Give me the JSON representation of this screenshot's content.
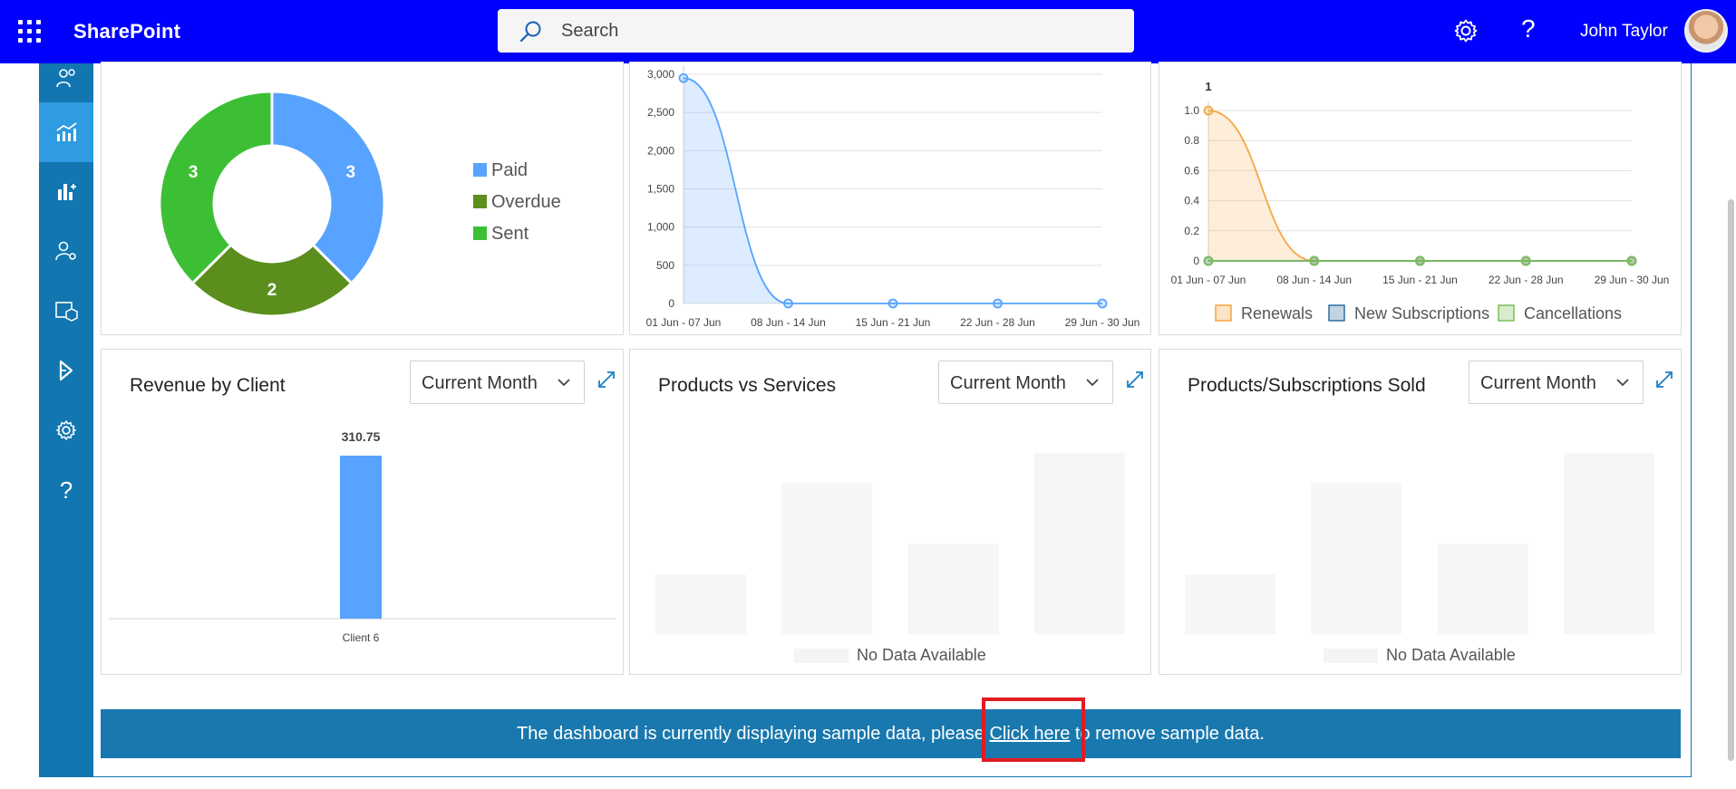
{
  "topbar": {
    "app_name": "SharePoint",
    "search_placeholder": "Search",
    "user_name": "John Taylor"
  },
  "invoice_status": {
    "legend": [
      "Paid",
      "Overdue",
      "Sent"
    ],
    "colors": [
      "#57a3ff",
      "#5b8e1d",
      "#3dbf35"
    ],
    "values": [
      3,
      2,
      3
    ]
  },
  "chart_data": [
    {
      "type": "pie",
      "variant": "donut",
      "categories": [
        "Paid",
        "Overdue",
        "Sent"
      ],
      "values": [
        3,
        2,
        3
      ],
      "colors": [
        "#57a3ff",
        "#5b8e1d",
        "#3dbf35"
      ],
      "legend_position": "right"
    },
    {
      "type": "area",
      "categories": [
        "01 Jun - 07 Jun",
        "08 Jun - 14 Jun",
        "15 Jun - 21 Jun",
        "22 Jun - 28 Jun",
        "29 Jun - 30 Jun"
      ],
      "values": [
        2950,
        0,
        0,
        0,
        0
      ],
      "ylim": [
        0,
        3000
      ],
      "yticks": [
        "3,000",
        "2,500",
        "2,000",
        "1,500",
        "1,000",
        "500",
        "0"
      ],
      "color": "#57a3ff",
      "grid": true
    },
    {
      "type": "area",
      "categories": [
        "01 Jun - 07 Jun",
        "08 Jun - 14 Jun",
        "15 Jun - 21 Jun",
        "22 Jun - 28 Jun",
        "29 Jun - 30 Jun"
      ],
      "series": [
        {
          "name": "Renewals",
          "values": [
            1,
            0,
            0,
            0,
            0
          ],
          "color": "#f5a742"
        },
        {
          "name": "New Subscriptions",
          "values": [
            0,
            0,
            0,
            0,
            0
          ],
          "color": "#2f6f9f"
        },
        {
          "name": "Cancellations",
          "values": [
            0,
            0,
            0,
            0,
            0
          ],
          "color": "#7bbf5a"
        }
      ],
      "ylim": [
        0,
        1.0
      ],
      "yticks": [
        "1.0",
        "0.8",
        "0.6",
        "0.4",
        "0.2",
        "0"
      ],
      "data_label": "1",
      "legend_position": "bottom",
      "grid": true
    },
    {
      "type": "bar",
      "title": "Revenue by Client",
      "categories": [
        "Client 6"
      ],
      "values": [
        310.75
      ],
      "value_labels": [
        "310.75"
      ],
      "color": "#57a3ff"
    }
  ],
  "cards": {
    "revenue_by_client": {
      "title": "Revenue by Client",
      "period": "Current Month"
    },
    "products_vs_services": {
      "title": "Products vs Services",
      "period": "Current Month",
      "empty_text": "No Data Available"
    },
    "products_sold": {
      "title": "Products/Subscriptions Sold",
      "period": "Current Month",
      "empty_text": "No Data Available"
    }
  },
  "banner": {
    "before": "The dashboard is currently displaying sample data, please ",
    "link": "Click here",
    "after": " to remove sample data."
  }
}
